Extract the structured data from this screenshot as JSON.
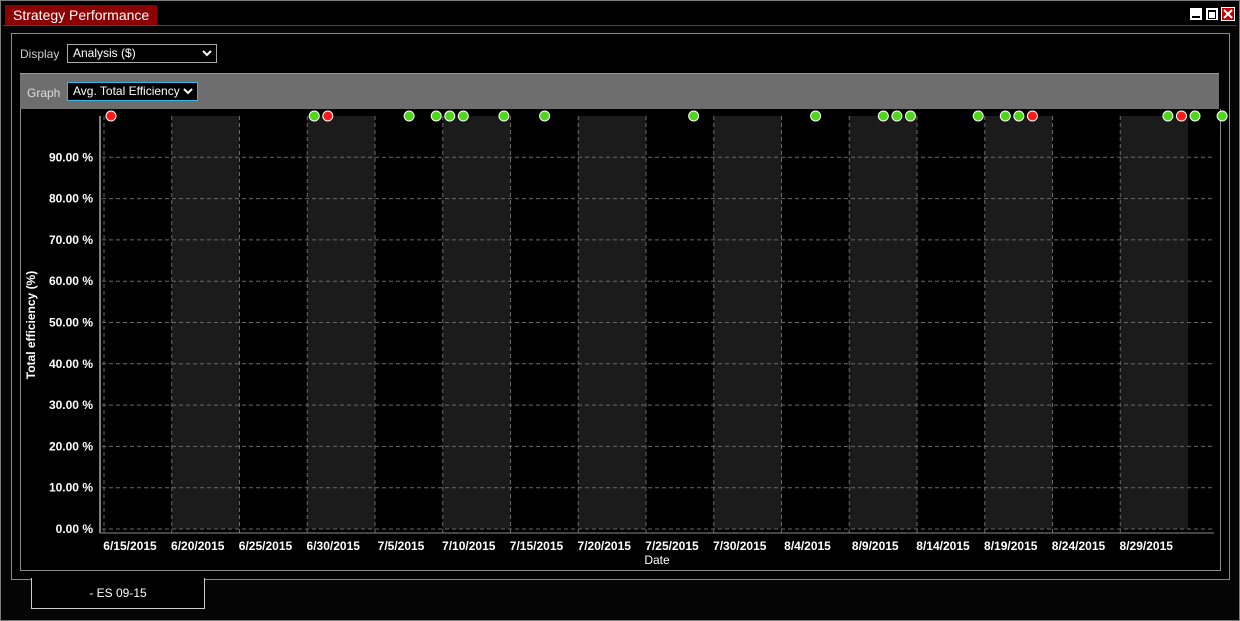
{
  "window": {
    "title": "Strategy Performance"
  },
  "display": {
    "label": "Display",
    "value": "Analysis ($)"
  },
  "graph": {
    "label": "Graph",
    "value": "Avg. Total Efficiency"
  },
  "bottom_tab": {
    "label": "- ES 09-15"
  },
  "colors": {
    "title_tab": "#8b0000",
    "win_marker": "#4fd61d",
    "loss_marker": "#ff1a1a",
    "shade_band": "#1b1b1b"
  },
  "chart_data": {
    "type": "scatter",
    "xlabel": "Date",
    "ylabel": "Total efficiency (%)",
    "ylim": [
      0,
      100
    ],
    "grid": true,
    "y_ticks": [
      "0.00 %",
      "10.00 %",
      "20.00 %",
      "30.00 %",
      "40.00 %",
      "50.00 %",
      "60.00 %",
      "70.00 %",
      "80.00 %",
      "90.00 %"
    ],
    "x_ticks": [
      "6/15/2015",
      "6/20/2015",
      "6/25/2015",
      "6/30/2015",
      "7/5/2015",
      "7/10/2015",
      "7/15/2015",
      "7/20/2015",
      "7/25/2015",
      "7/30/2015",
      "8/4/2015",
      "8/9/2015",
      "8/14/2015",
      "8/19/2015",
      "8/24/2015",
      "8/29/2015"
    ],
    "points": [
      {
        "x": "6/15/2015",
        "y": 100,
        "result": "loss"
      },
      {
        "x": "6/30/2015",
        "y": 100,
        "result": "win"
      },
      {
        "x": "7/1/2015",
        "y": 100,
        "result": "loss"
      },
      {
        "x": "7/7/2015",
        "y": 100,
        "result": "win"
      },
      {
        "x": "7/9/2015",
        "y": 100,
        "result": "win"
      },
      {
        "x": "7/10/2015",
        "y": 100,
        "result": "win"
      },
      {
        "x": "7/11/2015",
        "y": 100,
        "result": "win"
      },
      {
        "x": "7/14/2015",
        "y": 100,
        "result": "win"
      },
      {
        "x": "7/17/2015",
        "y": 100,
        "result": "win"
      },
      {
        "x": "7/28/2015",
        "y": 100,
        "result": "win"
      },
      {
        "x": "8/6/2015",
        "y": 100,
        "result": "win"
      },
      {
        "x": "8/11/2015",
        "y": 100,
        "result": "win"
      },
      {
        "x": "8/12/2015",
        "y": 100,
        "result": "win"
      },
      {
        "x": "8/13/2015",
        "y": 100,
        "result": "win"
      },
      {
        "x": "8/18/2015",
        "y": 100,
        "result": "win"
      },
      {
        "x": "8/20/2015",
        "y": 100,
        "result": "win"
      },
      {
        "x": "8/21/2015",
        "y": 100,
        "result": "win"
      },
      {
        "x": "8/22/2015",
        "y": 100,
        "result": "loss"
      },
      {
        "x": "9/1/2015",
        "y": 100,
        "result": "win"
      },
      {
        "x": "9/2/2015",
        "y": 100,
        "result": "loss"
      },
      {
        "x": "9/3/2015",
        "y": 100,
        "result": "win"
      },
      {
        "x": "9/5/2015",
        "y": 100,
        "result": "win"
      }
    ]
  }
}
